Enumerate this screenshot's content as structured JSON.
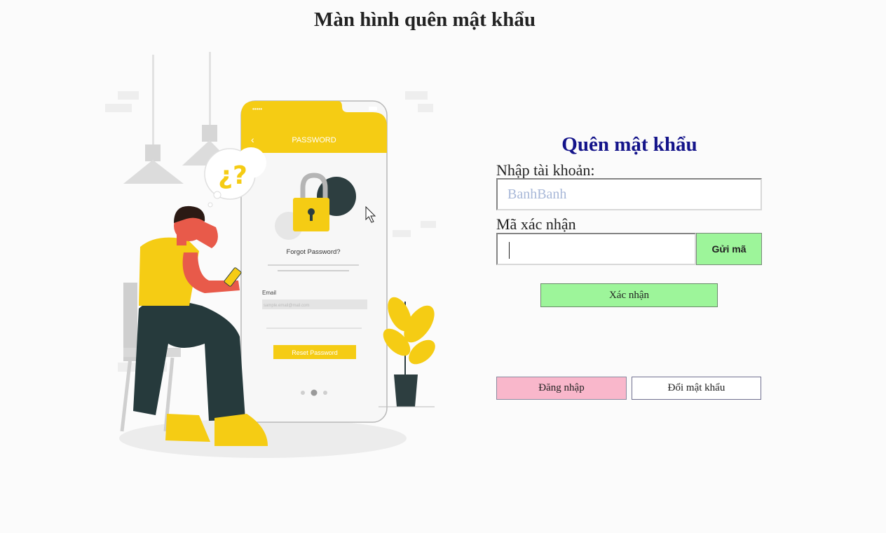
{
  "page": {
    "title": "Màn hình quên mật khẩu"
  },
  "illustration": {
    "header": "PASSWORD",
    "forgot_text": "Forgot Password?",
    "email_label": "Email",
    "email_value": "sample.email@mail.com",
    "reset_button": "Reset Password",
    "thought": "¿?"
  },
  "form": {
    "title": "Quên mật khẩu",
    "account_label": "Nhập tài khoản:",
    "account_placeholder": "BanhBanh",
    "code_label": "Mã xác nhận",
    "code_value": "",
    "send_code_button": "Gửi mã",
    "confirm_button": "Xác nhận",
    "login_button": "Đăng nhập",
    "change_password_button": "Đổi mật khẩu"
  },
  "colors": {
    "title_blue": "#14148a",
    "green_button": "#9df59a",
    "pink_button": "#f9b7cb",
    "accent_yellow": "#f5cc14"
  }
}
